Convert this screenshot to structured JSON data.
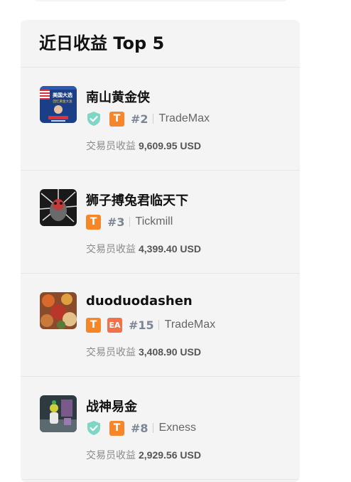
{
  "panel": {
    "title": "近日收益 Top 5"
  },
  "traders": [
    {
      "name": "南山黄金侠",
      "verified": true,
      "badges": [
        "T"
      ],
      "rank": "#2",
      "broker": "TradeMax",
      "earn_label": "交易员收益",
      "earn_value": "9,609.95 USD",
      "avatar_text_1": "美国大选",
      "avatar_text_2": "回忆黄金大涨"
    },
    {
      "name": "狮子搏兔君临天下",
      "verified": false,
      "badges": [
        "T"
      ],
      "rank": "#3",
      "broker": "Tickmill",
      "earn_label": "交易员收益",
      "earn_value": "4,399.40 USD"
    },
    {
      "name": "duoduodashen",
      "verified": false,
      "badges": [
        "T",
        "EA"
      ],
      "rank": "#15",
      "broker": "TradeMax",
      "earn_label": "交易员收益",
      "earn_value": "3,408.90 USD"
    },
    {
      "name": "战神易金",
      "verified": true,
      "badges": [
        "T"
      ],
      "rank": "#8",
      "broker": "Exness",
      "earn_label": "交易员收益",
      "earn_value": "2,929.56 USD"
    }
  ],
  "colors": {
    "panel_bg": "#f4f4f4",
    "badge_orange": "#f5872a",
    "badge_ea": "#f0714a",
    "shield_teal": "#7ed6c4",
    "rank_gray": "#7b8694"
  },
  "icons": {
    "verified": "shield-check-icon"
  }
}
